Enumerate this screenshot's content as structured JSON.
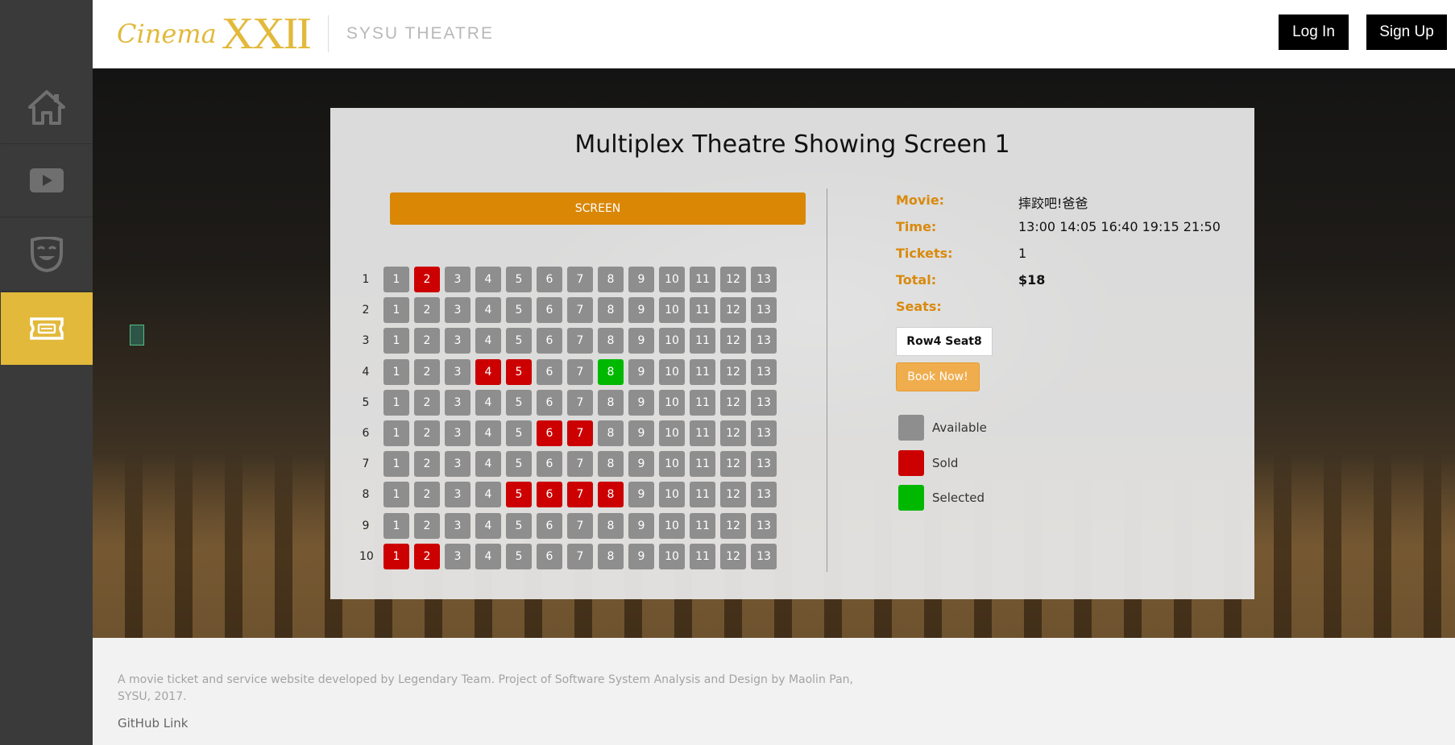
{
  "header": {
    "logo_cinema": "Cinema",
    "logo_xxii": "XXII",
    "logo_subtitle": "SYSU THEATRE",
    "login_label": "Log In",
    "signup_label": "Sign Up"
  },
  "sidebar": {
    "items": [
      {
        "icon": "home-icon",
        "active": false
      },
      {
        "icon": "play-icon",
        "active": false
      },
      {
        "icon": "theatre-mask-icon",
        "active": false
      },
      {
        "icon": "ticket-icon",
        "active": true
      }
    ]
  },
  "panel": {
    "title": "Multiplex Theatre Showing Screen 1",
    "screen_label": "SCREEN",
    "rows": [
      {
        "label": "1",
        "seats": [
          "1",
          "2",
          "3",
          "4",
          "5",
          "6",
          "7",
          "8",
          "9",
          "10",
          "11",
          "12",
          "13"
        ],
        "sold": [
          2
        ],
        "selected": []
      },
      {
        "label": "2",
        "seats": [
          "1",
          "2",
          "3",
          "4",
          "5",
          "6",
          "7",
          "8",
          "9",
          "10",
          "11",
          "12",
          "13"
        ],
        "sold": [],
        "selected": []
      },
      {
        "label": "3",
        "seats": [
          "1",
          "2",
          "3",
          "4",
          "5",
          "6",
          "7",
          "8",
          "9",
          "10",
          "11",
          "12",
          "13"
        ],
        "sold": [],
        "selected": []
      },
      {
        "label": "4",
        "seats": [
          "1",
          "2",
          "3",
          "4",
          "5",
          "6",
          "7",
          "8",
          "9",
          "10",
          "11",
          "12",
          "13"
        ],
        "sold": [
          4,
          5
        ],
        "selected": [
          8
        ]
      },
      {
        "label": "5",
        "seats": [
          "1",
          "2",
          "3",
          "4",
          "5",
          "6",
          "7",
          "8",
          "9",
          "10",
          "11",
          "12",
          "13"
        ],
        "sold": [],
        "selected": []
      },
      {
        "label": "6",
        "seats": [
          "1",
          "2",
          "3",
          "4",
          "5",
          "6",
          "7",
          "8",
          "9",
          "10",
          "11",
          "12",
          "13"
        ],
        "sold": [
          6,
          7
        ],
        "selected": []
      },
      {
        "label": "7",
        "seats": [
          "1",
          "2",
          "3",
          "4",
          "5",
          "6",
          "7",
          "8",
          "9",
          "10",
          "11",
          "12",
          "13"
        ],
        "sold": [],
        "selected": []
      },
      {
        "label": "8",
        "seats": [
          "1",
          "2",
          "3",
          "4",
          "5",
          "6",
          "7",
          "8",
          "9",
          "10",
          "11",
          "12",
          "13"
        ],
        "sold": [
          5,
          6,
          7,
          8
        ],
        "selected": []
      },
      {
        "label": "9",
        "seats": [
          "1",
          "2",
          "3",
          "4",
          "5",
          "6",
          "7",
          "8",
          "9",
          "10",
          "11",
          "12",
          "13"
        ],
        "sold": [],
        "selected": []
      },
      {
        "label": "10",
        "seats": [
          "1",
          "2",
          "3",
          "4",
          "5",
          "6",
          "7",
          "8",
          "9",
          "10",
          "11",
          "12",
          "13"
        ],
        "sold": [
          1,
          2
        ],
        "selected": []
      }
    ],
    "info": {
      "movie_label": "Movie:",
      "movie_value": "摔跤吧!爸爸",
      "time_label": "Time:",
      "time_value": "13:00 14:05 16:40 19:15 21:50",
      "tickets_label": "Tickets:",
      "tickets_value": "1",
      "total_label": "Total:",
      "total_value": "$18",
      "seats_label": "Seats:",
      "selected_seat": "Row4 Seat8",
      "book_label": "Book Now!"
    },
    "legend": [
      {
        "label": "Available",
        "color": "#8e8e8e"
      },
      {
        "label": "Sold",
        "color": "#cc0000"
      },
      {
        "label": "Selected",
        "color": "#00b800"
      }
    ]
  },
  "footer": {
    "text": "A movie ticket and service website developed by Legendary Team. Project of Software System Analysis and Design by Maolin Pan, SYSU, 2017.",
    "github_label": "GitHub Link"
  }
}
